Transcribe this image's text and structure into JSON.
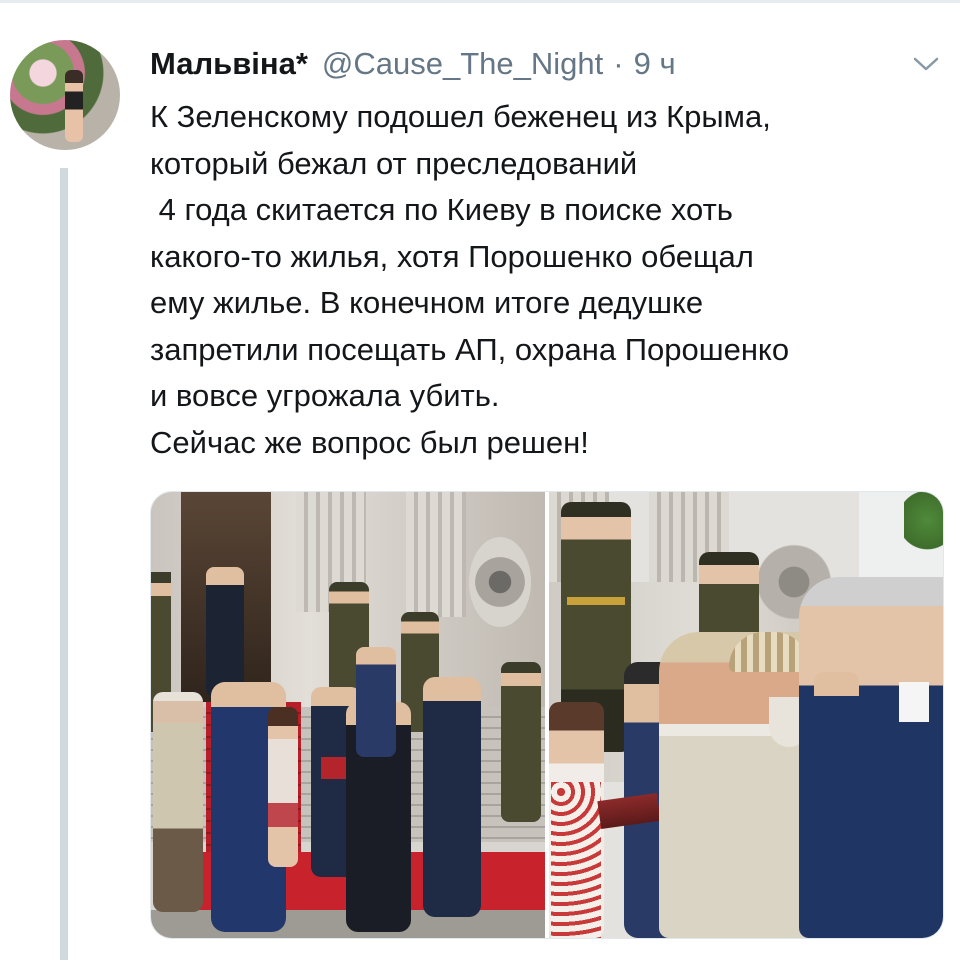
{
  "tweet": {
    "author_name": "Мальвіна*",
    "handle": "@Cause_The_Night",
    "separator": "·",
    "time": "9 ч",
    "text_lines": [
      "К Зеленскому подошел беженец из Крыма,",
      "который бежал от преследований",
      " 4 года скитается по Киеву в поиске хоть",
      "какого-то жилья, хотя Порошенко обещал",
      "ему жилье. В конечном итоге дедушке",
      "запретили посещать АП, охрана Порошенко",
      "и вовсе угрожала убить.",
      "Сейчас же вопрос был решен!"
    ]
  },
  "icons": {
    "menu": "chevron-down-icon"
  },
  "colors": {
    "text": "#14171a",
    "secondary_text": "#657786",
    "thread_line": "#cfd9de",
    "red_carpet": "#c8232c",
    "navy_suit": "#1f3564",
    "uniform_olive": "#4a4a30"
  }
}
